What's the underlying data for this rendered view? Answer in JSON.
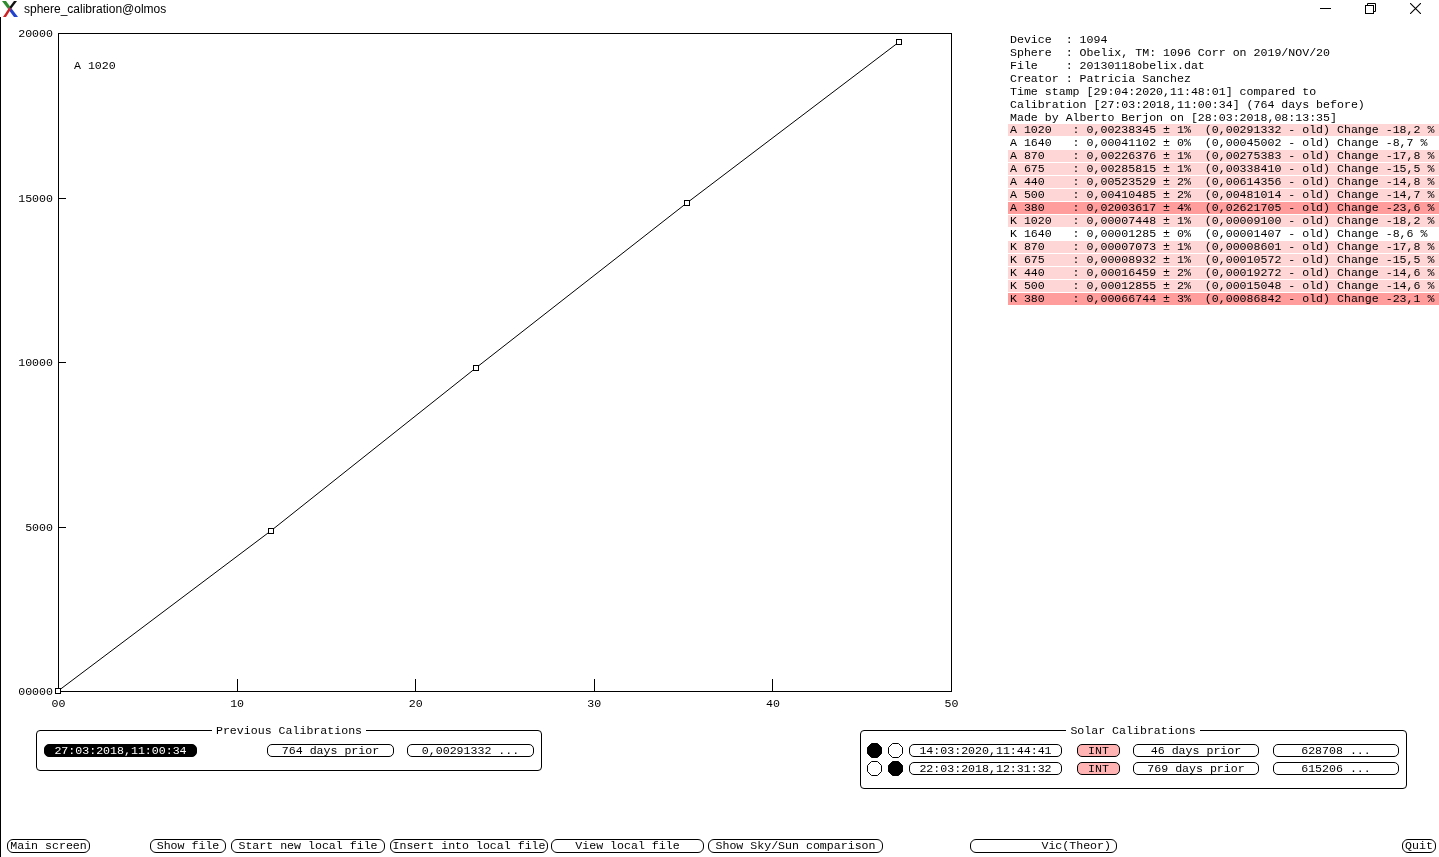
{
  "window": {
    "title": "sphere_calibration@olmos"
  },
  "chart": {
    "chart_data": {
      "type": "line",
      "title": "A 1020",
      "x": [
        0,
        11.9,
        23.4,
        35.2,
        47.1
      ],
      "series": [
        {
          "color": "#000000",
          "marker": "square",
          "values": [
            0,
            4860,
            9820,
            14830,
            19730
          ]
        }
      ],
      "xlim": [
        0,
        50
      ],
      "ylim": [
        0,
        20000
      ],
      "xticks": [
        {
          "value": 0,
          "label": "00"
        },
        10,
        20,
        30,
        40,
        50
      ],
      "yticks": [
        {
          "value": 0,
          "label": "00000"
        },
        5000,
        10000,
        15000,
        20000
      ]
    }
  },
  "info": {
    "lines": [
      "Device  : 1094",
      "Sphere  : Obelix, TM: 1096 Corr on 2019/NOV/20",
      "File    : 20130118obelix.dat",
      "Creator : Patricia Sanchez",
      "Time stamp [29:04:2020,11:48:01] compared to",
      "Calibration [27:03:2018,11:00:34] (764 days before)",
      "Made by Alberto Berjon on [28:03:2018,08:13:35]"
    ],
    "rows": [
      {
        "text": "A 1020   : 0,00238345 ± 1%  (0,00291332 - old) Change -18,2 %",
        "color": "#ffd6d6"
      },
      {
        "text": "A 1640   : 0,00041102 ± 0%  (0,00045002 - old) Change -8,7 %",
        "color": "#ffffff"
      },
      {
        "text": "A 870    : 0,00226376 ± 1%  (0,00275383 - old) Change -17,8 %",
        "color": "#ffd6d6"
      },
      {
        "text": "A 675    : 0,00285815 ± 1%  (0,00338410 - old) Change -15,5 %",
        "color": "#ffd6d6"
      },
      {
        "text": "A 440    : 0,00523529 ± 2%  (0,00614356 - old) Change -14,8 %",
        "color": "#ffd6d6"
      },
      {
        "text": "A 500    : 0,00410485 ± 2%  (0,00481014 - old) Change -14,7 %",
        "color": "#ffd6d6"
      },
      {
        "text": "A 380    : 0,02003617 ± 4%  (0,02621705 - old) Change -23,6 %",
        "color": "#ff9c9c"
      },
      {
        "text": "K 1020   : 0,00007448 ± 1%  (0,00009100 - old) Change -18,2 %",
        "color": "#ffd6d6"
      },
      {
        "text": "K 1640   : 0,00001285 ± 0%  (0,00001407 - old) Change -8,6 %",
        "color": "#ffffff"
      },
      {
        "text": "K 870    : 0,00007073 ± 1%  (0,00008601 - old) Change -17,8 %",
        "color": "#ffd6d6"
      },
      {
        "text": "K 675    : 0,00008932 ± 1%  (0,00010572 - old) Change -15,5 %",
        "color": "#ffd6d6"
      },
      {
        "text": "K 440    : 0,00016459 ± 2%  (0,00019272 - old) Change -14,6 %",
        "color": "#ffd6d6"
      },
      {
        "text": "K 500    : 0,00012855 ± 2%  (0,00015048 - old) Change -14,6 %",
        "color": "#ffd6d6"
      },
      {
        "text": "K 380    : 0,00066744 ± 3%  (0,00086842 - old) Change -23,1 %",
        "color": "#ff9c9c"
      }
    ]
  },
  "previous_calibrations": {
    "title": "Previous Calibrations",
    "rows": [
      {
        "date": "27:03:2018,11:00:34",
        "selected": true,
        "age": "764 days prior",
        "value": "0,00291332 ..."
      }
    ]
  },
  "solar_calibrations": {
    "title": "Solar Calibrations",
    "rows": [
      {
        "markers": [
          {
            "selected": true
          },
          {
            "selected": false
          }
        ],
        "date": "14:03:2020,11:44:41",
        "selected": false,
        "type": "INT",
        "age": "46 days prior",
        "value": "628708 ..."
      },
      {
        "markers": [
          {
            "selected": false
          },
          {
            "selected": true
          }
        ],
        "date": "22:03:2018,12:31:32",
        "selected": false,
        "type": "INT",
        "age": "769 days prior",
        "value": "615206 ..."
      }
    ]
  },
  "buttons": [
    {
      "label": "Main screen"
    },
    {
      "label": "Show file"
    },
    {
      "label": "Start new local file"
    },
    {
      "label": "Insert into local file"
    },
    {
      "label": "View local file"
    },
    {
      "label": "Show Sky/Sun comparison"
    },
    {
      "label": "Vic(Theor)"
    },
    {
      "label": "Quit"
    }
  ]
}
